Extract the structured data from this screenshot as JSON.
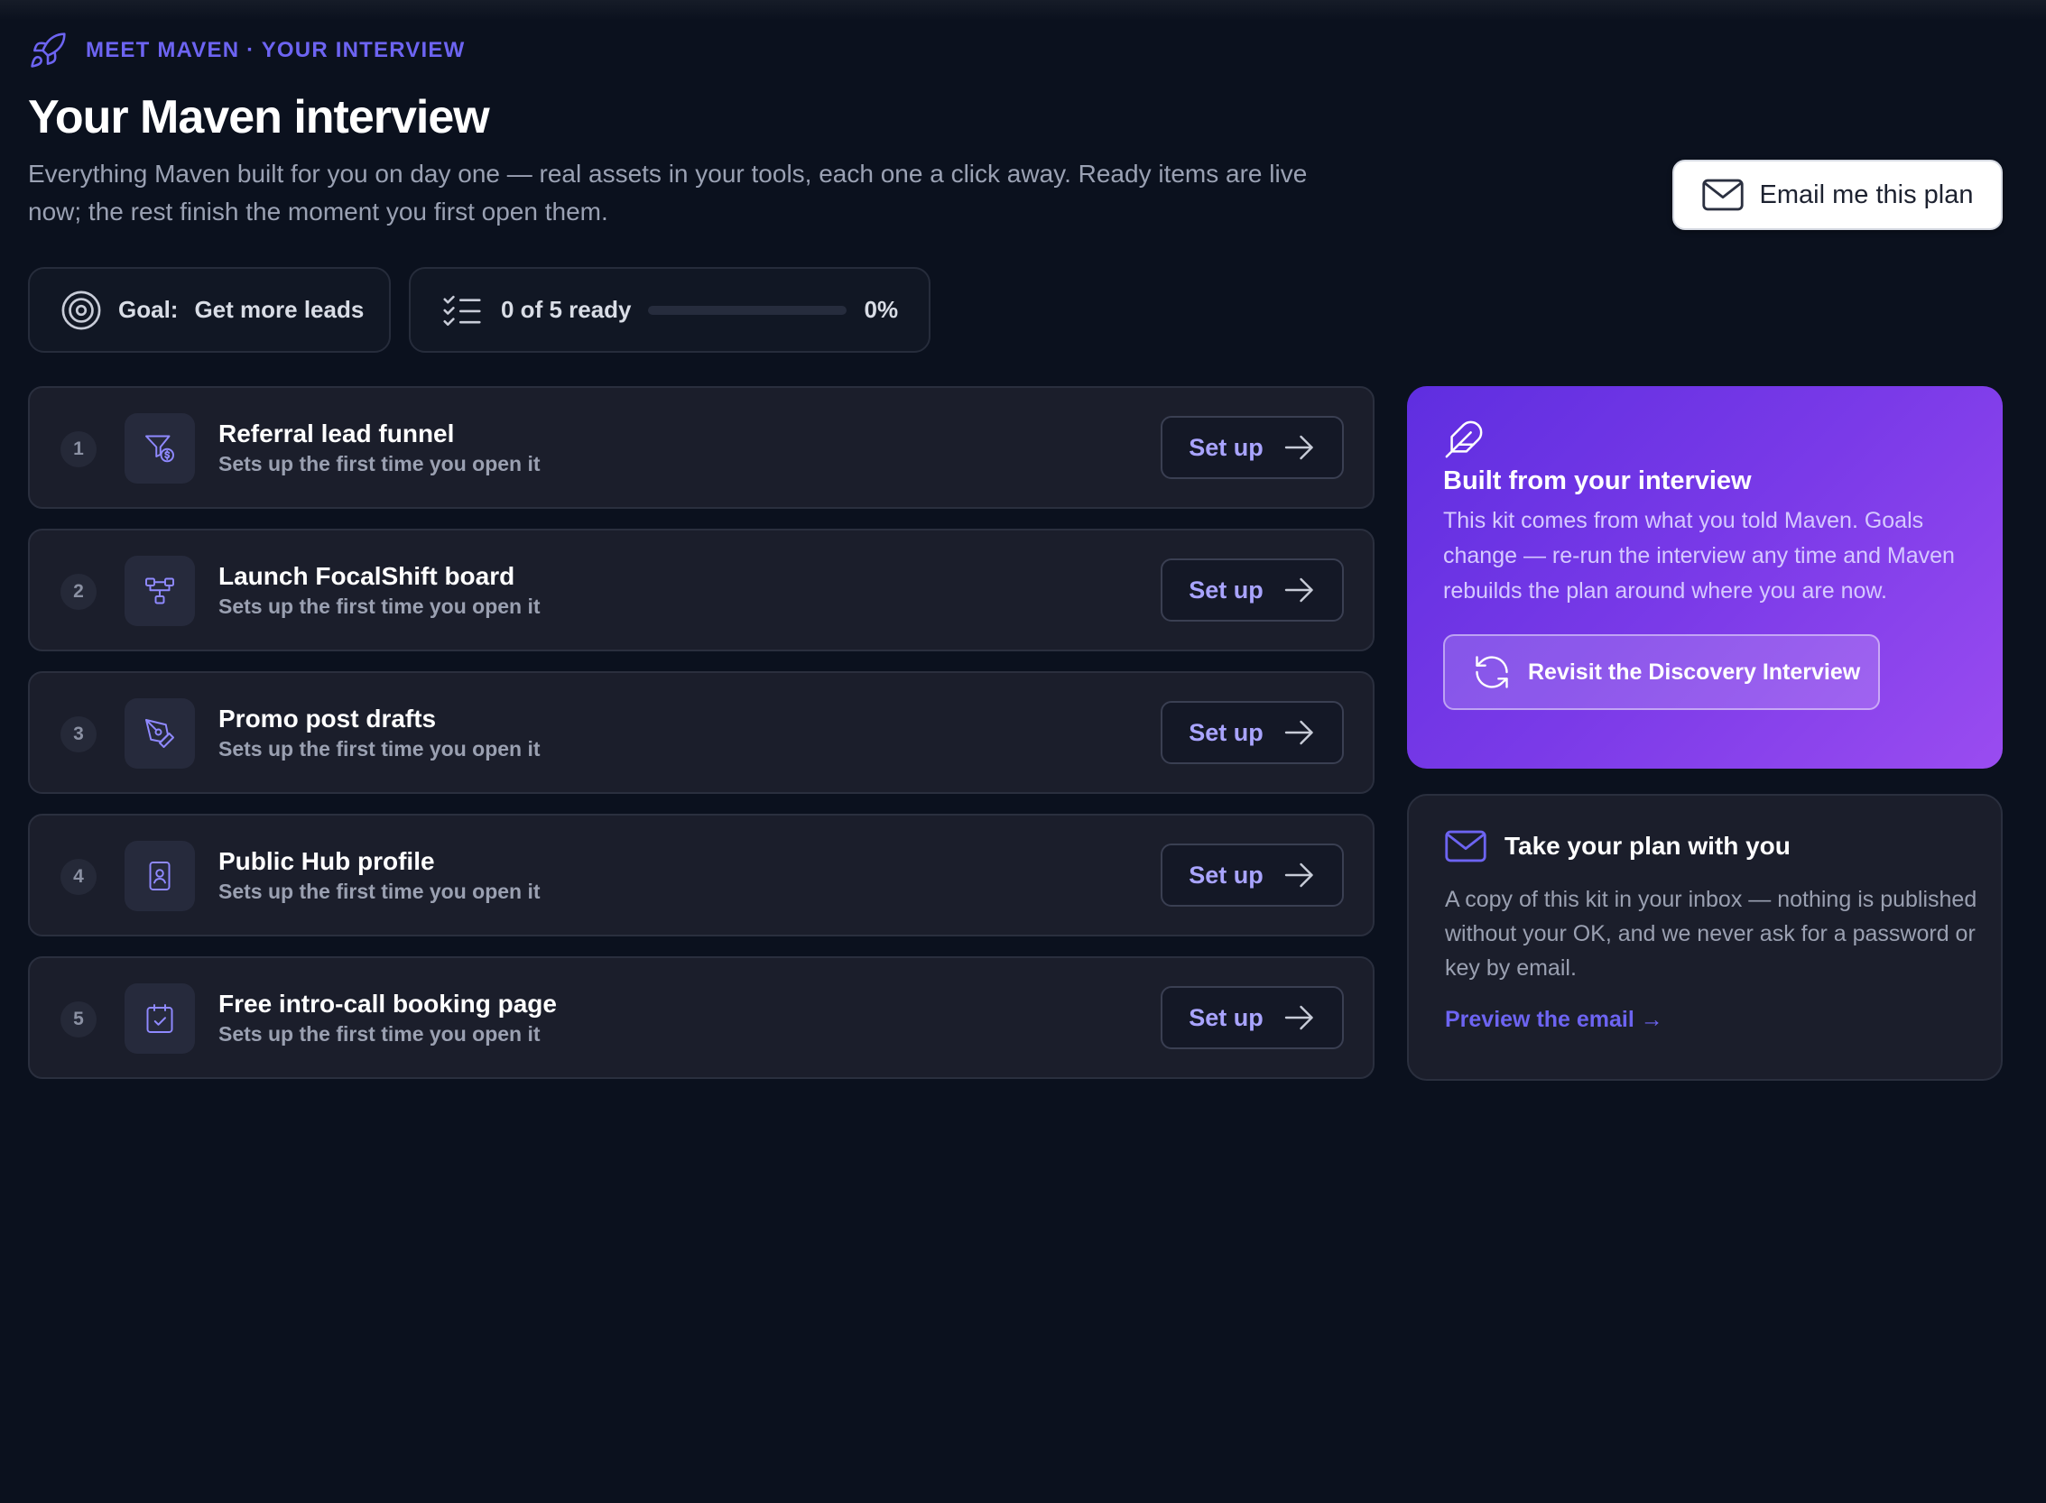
{
  "header": {
    "eyebrow": "MEET MAVEN · YOUR INTERVIEW",
    "eyebrow_icon": "rocket-icon",
    "title": "Your Maven interview",
    "subtitle": "Everything Maven built for you on day one — real assets in your tools, each one a click away. Ready items are live now; the rest finish the moment you first open them.",
    "email_button": "Email me this plan"
  },
  "goal": {
    "label": "Goal:",
    "value": "Get more leads",
    "icon": "target-icon"
  },
  "progress": {
    "label": "0 of 5 ready",
    "percent_label": "0%",
    "fraction": 0,
    "icon": "checklist-icon"
  },
  "tasks": [
    {
      "number": "1",
      "title": "Referral lead funnel",
      "subtitle": "Sets up the first time you open it",
      "action": "Set up",
      "icon": "funnel-dollar-icon"
    },
    {
      "number": "2",
      "title": "Launch FocalShift board",
      "subtitle": "Sets up the first time you open it",
      "action": "Set up",
      "icon": "workflow-icon"
    },
    {
      "number": "3",
      "title": "Promo post drafts",
      "subtitle": "Sets up the first time you open it",
      "action": "Set up",
      "icon": "pen-nib-icon"
    },
    {
      "number": "4",
      "title": "Public Hub profile",
      "subtitle": "Sets up the first time you open it",
      "action": "Set up",
      "icon": "profile-badge-icon"
    },
    {
      "number": "5",
      "title": "Free intro-call booking page",
      "subtitle": "Sets up the first time you open it",
      "action": "Set up",
      "icon": "calendar-check-icon"
    }
  ],
  "interview_card": {
    "title": "Built from your interview",
    "body": "This kit comes from what you told Maven. Goals change — re-run the interview any time and Maven rebuilds the plan around where you are now.",
    "button": "Revisit the Discovery Interview",
    "icon": "feather-icon"
  },
  "plan_card": {
    "title": "Take your plan with you",
    "body": "A copy of this kit in your inbox — nothing is published without your OK, and we never ask for a password or key by email.",
    "link": "Preview the email →",
    "icon": "mail-icon"
  },
  "colors": {
    "accent": "#6d64f2",
    "background": "#0b111e",
    "card": "#1b1e2b",
    "gradient_start": "#5f2ee0",
    "gradient_end": "#9a4cf0"
  }
}
